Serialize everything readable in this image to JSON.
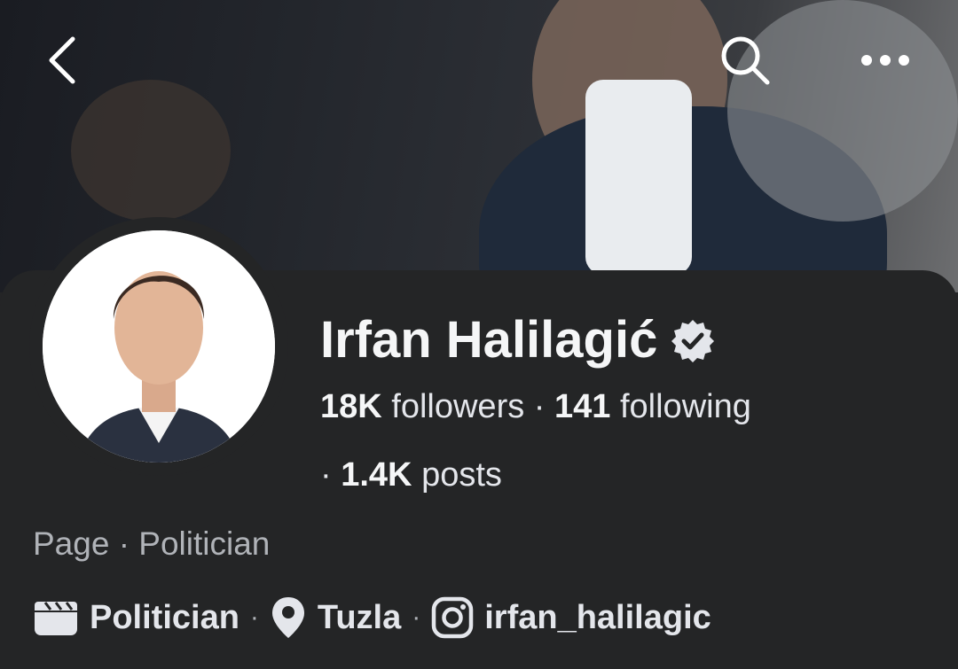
{
  "profile": {
    "name": "Irfan Halilagić",
    "followers_count": "18K",
    "followers_label": "followers",
    "following_count": "141",
    "following_label": "following",
    "posts_count": "1.4K",
    "posts_label": "posts",
    "dot": "·",
    "category_line": "Page · Politician",
    "details": {
      "category": "Politician",
      "location": "Tuzla",
      "instagram": "irfan_halilagic"
    }
  },
  "icons": {
    "back": "chevron-left-icon",
    "search": "search-icon",
    "more": "more-horizontal-icon",
    "verified": "verified-badge-icon",
    "category": "clapperboard-icon",
    "location": "map-pin-icon",
    "instagram": "instagram-icon"
  },
  "colors": {
    "background": "#242526",
    "text_primary": "#f5f6f7",
    "text_secondary": "#b0b3b8"
  }
}
